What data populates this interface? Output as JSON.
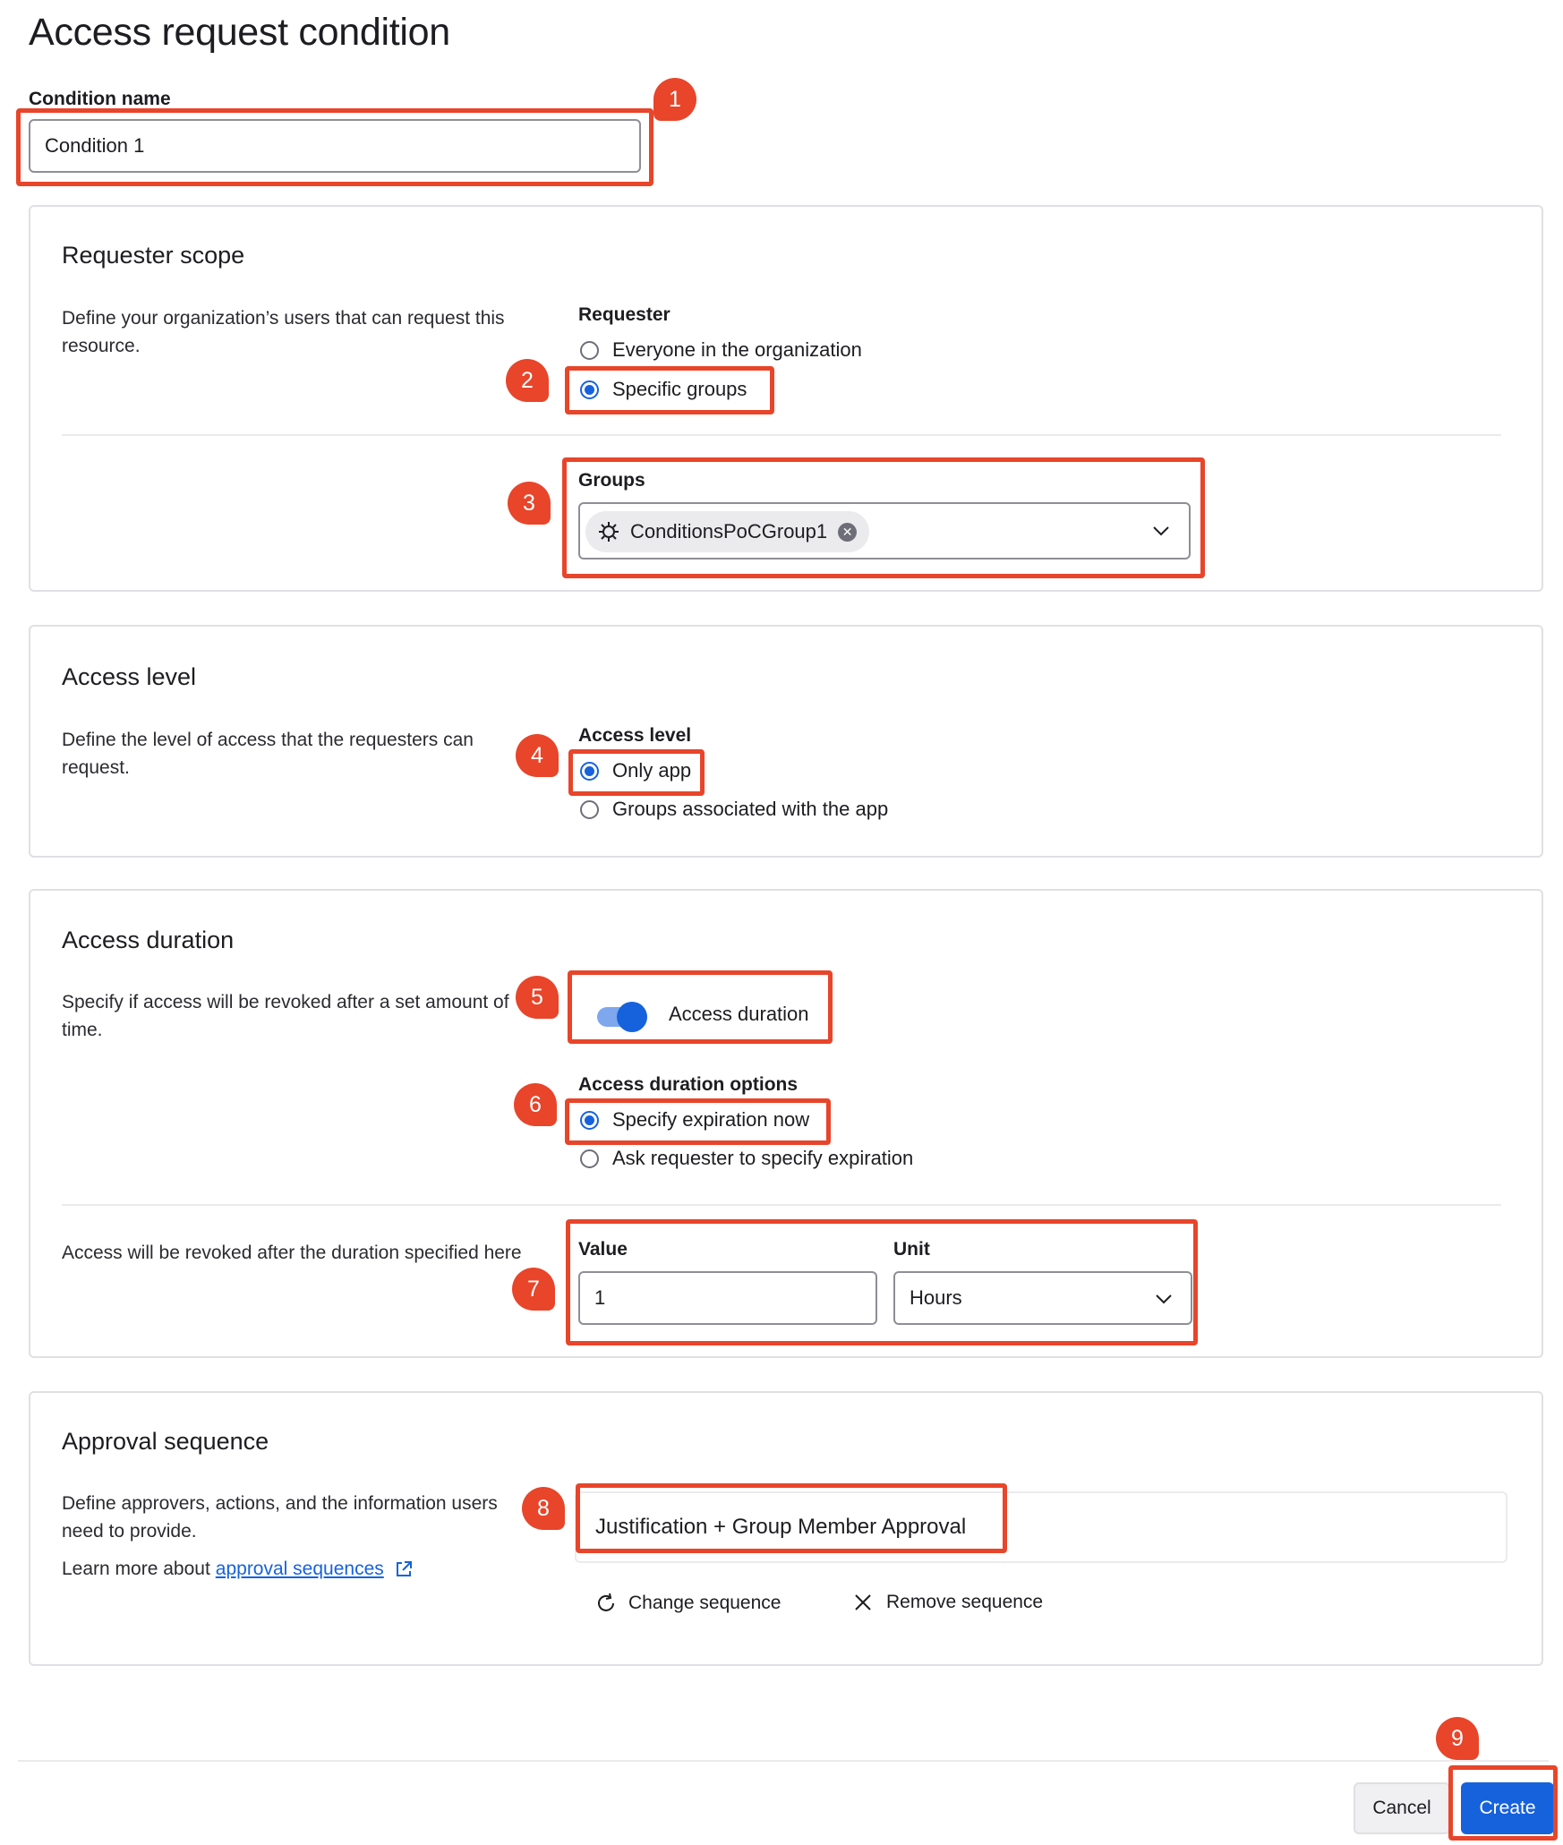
{
  "page": {
    "title": "Access request condition"
  },
  "condition_name": {
    "label": "Condition name",
    "value": "Condition 1"
  },
  "requester_scope": {
    "title": "Requester scope",
    "description": "Define your organization’s users that can request this resource.",
    "requester_label": "Requester",
    "options": [
      "Everyone in the organization",
      "Specific groups"
    ],
    "selected": "Specific groups",
    "groups_label": "Groups",
    "groups": [
      "ConditionsPoCGroup1"
    ]
  },
  "access_level": {
    "title": "Access level",
    "description": "Define the level of access that the requesters can request.",
    "label": "Access level",
    "options": [
      "Only app",
      "Groups associated with the app"
    ],
    "selected": "Only app"
  },
  "access_duration": {
    "title": "Access duration",
    "description": "Specify if access will be revoked after a set amount of time.",
    "toggle_label": "Access duration",
    "toggle_on": true,
    "options_label": "Access duration options",
    "options": [
      "Specify expiration now",
      "Ask requester to specify expiration"
    ],
    "selected": "Specify expiration now",
    "revoke_description": "Access will be revoked after the duration specified here",
    "value_label": "Value",
    "value": "1",
    "unit_label": "Unit",
    "unit": "Hours"
  },
  "approval_sequence": {
    "title": "Approval sequence",
    "description": "Define approvers, actions, and the information users need to provide.",
    "learn_more_prefix": "Learn more about",
    "learn_more_link": "approval sequences",
    "sequence_name": "Justification + Group Member Approval",
    "change_label": "Change sequence",
    "remove_label": "Remove sequence"
  },
  "footer": {
    "cancel_label": "Cancel",
    "create_label": "Create"
  },
  "callouts": [
    "1",
    "2",
    "3",
    "4",
    "5",
    "6",
    "7",
    "8",
    "9"
  ],
  "colors": {
    "accent": "#1662dd",
    "callout": "#e8452a"
  }
}
